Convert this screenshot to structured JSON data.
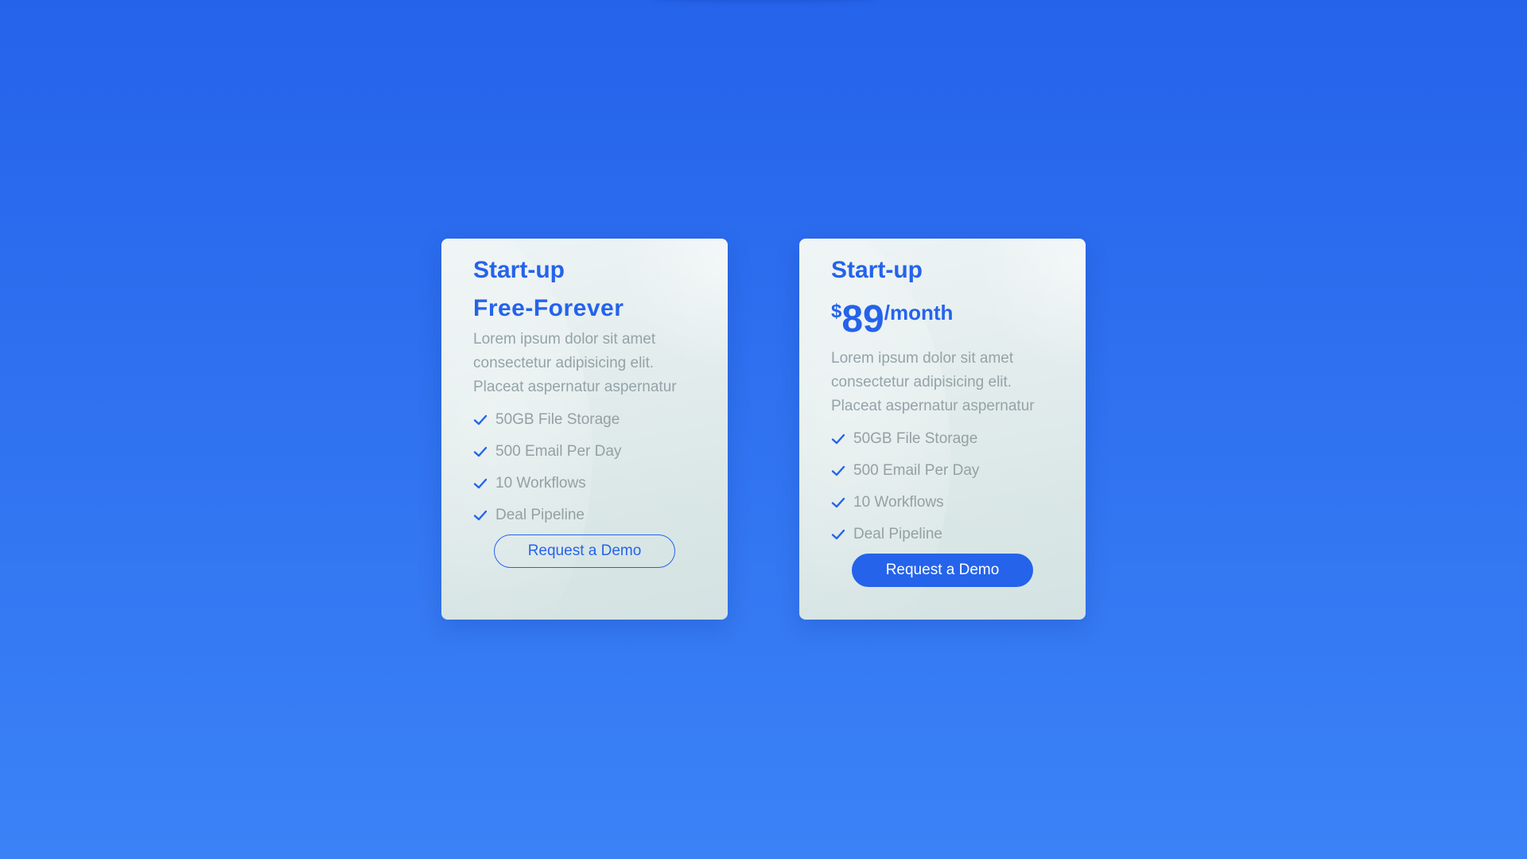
{
  "plans": [
    {
      "title": "Start-up",
      "price_text": "Free-Forever",
      "description": "Lorem ipsum dolor sit amet consectetur adipisicing elit. Placeat aspernatur aspernatur",
      "features": [
        "50GB File Storage",
        "500 Email Per Day",
        "10 Workflows",
        "Deal Pipeline"
      ],
      "button_label": "Request a Demo",
      "button_style": "outline"
    },
    {
      "title": "Start-up",
      "price": {
        "currency": "$",
        "amount": "89",
        "period": "/month"
      },
      "description": "Lorem ipsum dolor sit amet consectetur adipisicing elit. Placeat aspernatur aspernatur",
      "features": [
        "50GB File Storage",
        "500 Email Per Day",
        "10 Workflows",
        "Deal Pipeline"
      ],
      "button_label": "Request a Demo",
      "button_style": "filled"
    }
  ],
  "colors": {
    "accent": "#2563eb",
    "background_top": "#2563eb",
    "background_bottom": "#3b82f6",
    "muted_text": "#94a3a8",
    "card_bg": "#e1ebeb"
  },
  "icons": {
    "feature_bullet": "check-icon"
  }
}
